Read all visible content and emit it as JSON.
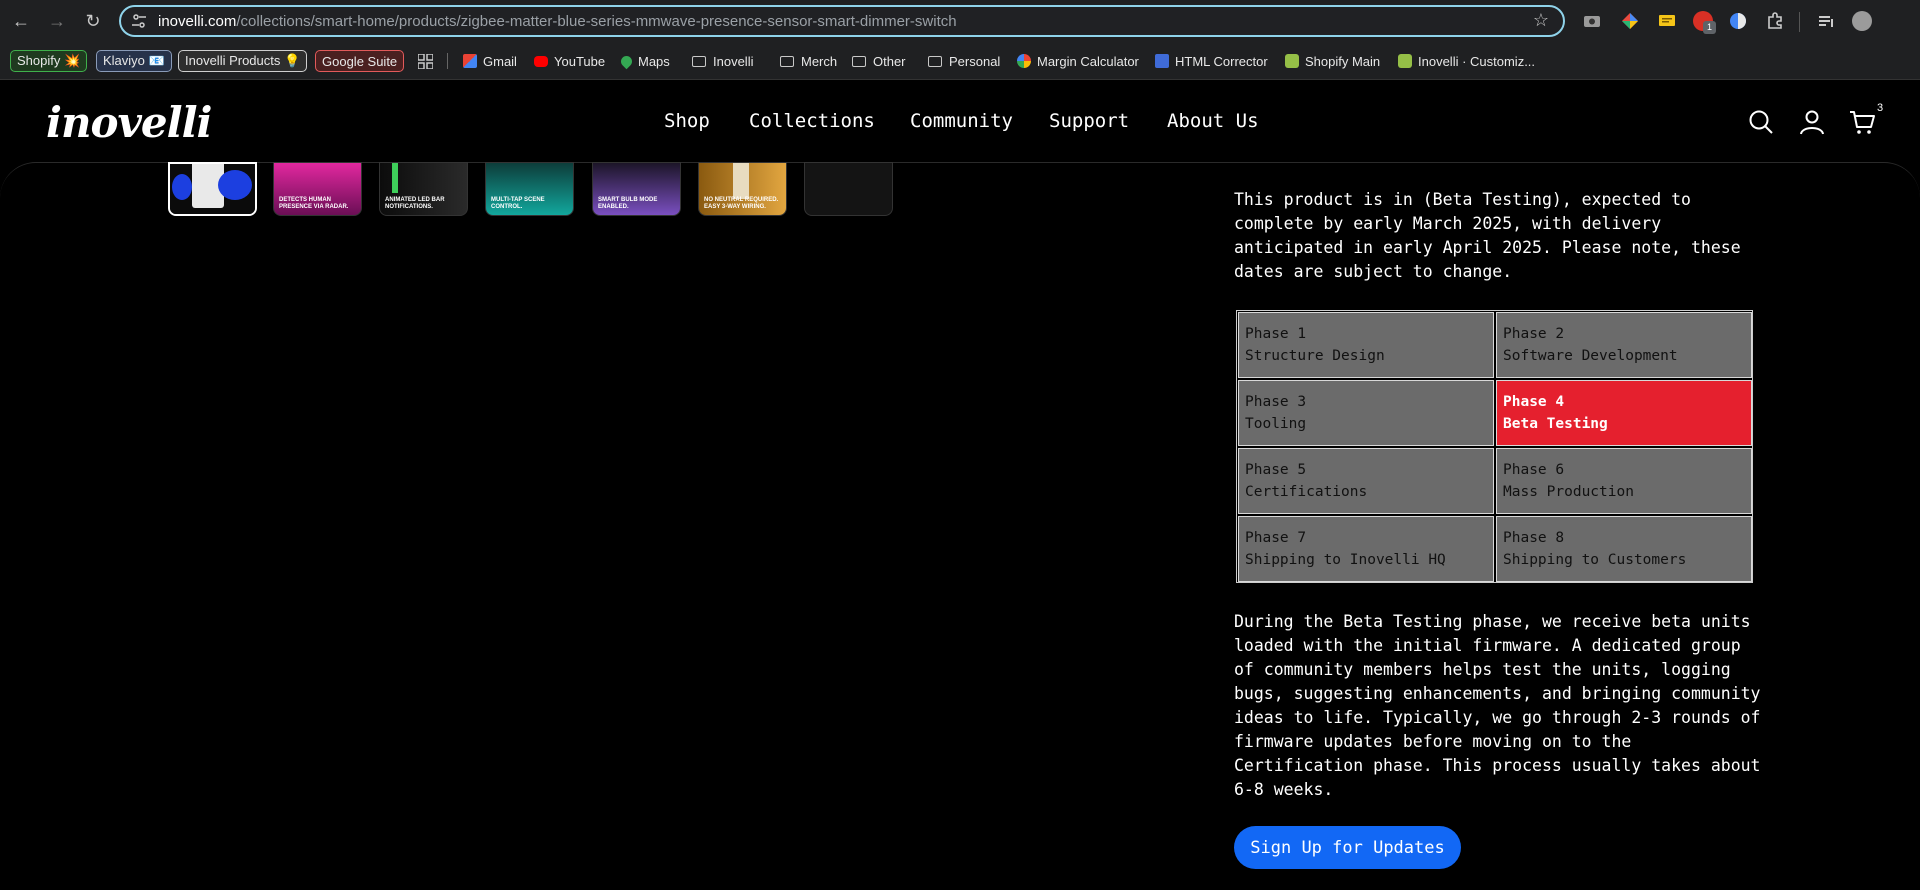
{
  "browser": {
    "url_host": "inovelli.com",
    "url_path": "/collections/smart-home/products/zigbee-matter-blue-series-mmwave-presence-sensor-smart-dimmer-switch",
    "extension_badge": "1",
    "bookmarks": [
      {
        "label": "Shopify 💥",
        "style": "pill",
        "color": "#3fb04b"
      },
      {
        "label": "Klaviyo 📧",
        "style": "pill",
        "color": "#8a9bb8"
      },
      {
        "label": "Inovelli Products 💡",
        "style": "pill",
        "color": "#cfcfcf"
      },
      {
        "label": "Google Suite",
        "style": "pill",
        "color": "#e25a5a"
      },
      {
        "label": "Gmail",
        "icon": "gmail-icon"
      },
      {
        "label": "YouTube",
        "icon": "youtube-icon"
      },
      {
        "label": "Maps",
        "icon": "maps-icon"
      },
      {
        "label": "Inovelli",
        "icon": "folder-icon"
      },
      {
        "label": "Merch",
        "icon": "folder-icon"
      },
      {
        "label": "Other",
        "icon": "folder-icon"
      },
      {
        "label": "Personal",
        "icon": "folder-icon"
      },
      {
        "label": "Margin Calculator",
        "icon": "google-icon"
      },
      {
        "label": "HTML Corrector",
        "icon": "html-corrector-icon"
      },
      {
        "label": "Shopify Main",
        "icon": "shopify-icon"
      },
      {
        "label": "Inovelli · Customiz...",
        "icon": "shopify-icon"
      }
    ]
  },
  "site": {
    "logo": "inovelli",
    "nav": [
      "Shop",
      "Collections",
      "Community",
      "Support",
      "About Us"
    ],
    "cart_count": "3"
  },
  "gallery": {
    "thumbnails": [
      {
        "caption": "",
        "color": "#d9d9d9"
      },
      {
        "caption": "DETECTS HUMAN PRESENCE VIA RADAR.",
        "color": "#c21a8c"
      },
      {
        "caption": "ANIMATED LED BAR NOTIFICATIONS.",
        "color": "#202020"
      },
      {
        "caption": "MULTI-TAP SCENE CONTROL.",
        "color": "#0f8a84"
      },
      {
        "caption": "SMART BULB MODE ENABLED.",
        "color": "#3b2a4d"
      },
      {
        "caption": "NO NEUTRAL REQUIRED. EASY 3-WAY WIRING.",
        "color": "#b87a1a"
      },
      {
        "caption": "",
        "color": "#141414"
      }
    ]
  },
  "product": {
    "status_text": "This product is in (Beta Testing), expected to complete by early March 2025, with delivery anticipated in early April 2025. Please note, these dates are subject to change.",
    "phases": [
      {
        "number": "Phase 1",
        "name": "Structure Design",
        "active": false
      },
      {
        "number": "Phase 2",
        "name": "Software Development",
        "active": false
      },
      {
        "number": "Phase 3",
        "name": "Tooling",
        "active": false
      },
      {
        "number": "Phase 4",
        "name": "Beta Testing",
        "active": true
      },
      {
        "number": "Phase 5",
        "name": "Certifications",
        "active": false
      },
      {
        "number": "Phase 6",
        "name": "Mass Production",
        "active": false
      },
      {
        "number": "Phase 7",
        "name": "Shipping to Inovelli HQ",
        "active": false
      },
      {
        "number": "Phase 8",
        "name": "Shipping to Customers",
        "active": false
      }
    ],
    "phase_description": "During the Beta Testing phase, we receive beta units loaded with the initial firmware. A dedicated group of community members helps test the units, logging bugs, suggesting enhancements, and bringing community ideas to life. Typically, we go through 2-3 rounds of firmware updates before moving on to the Certification phase. This process usually takes about 6-8 weeks.",
    "signup_label": "Sign Up for Updates"
  },
  "colors": {
    "active_phase": "#e5202e",
    "inactive_phase": "#6b6b6b",
    "button": "#1268f5",
    "omnibox_focus": "#8fd3ea"
  }
}
